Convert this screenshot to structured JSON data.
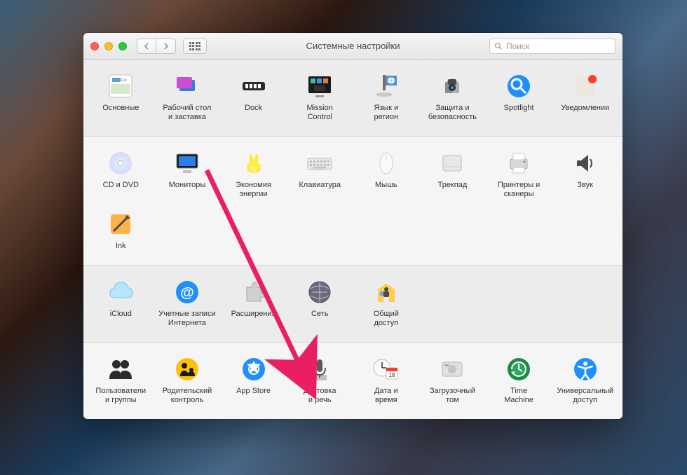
{
  "window": {
    "title": "Системные настройки",
    "search_placeholder": "Поиск"
  },
  "rows": [
    {
      "alt": false,
      "items": [
        {
          "id": "general",
          "label": "Основные"
        },
        {
          "id": "desktop",
          "label": "Рабочий стол\nи заставка"
        },
        {
          "id": "dock",
          "label": "Dock"
        },
        {
          "id": "mission",
          "label": "Mission\nControl"
        },
        {
          "id": "language",
          "label": "Язык и\nрегион"
        },
        {
          "id": "security",
          "label": "Защита и\nбезопасность"
        },
        {
          "id": "spotlight",
          "label": "Spotlight"
        },
        {
          "id": "notifications",
          "label": "Уведомления"
        }
      ]
    },
    {
      "alt": true,
      "items": [
        {
          "id": "cddvd",
          "label": "CD и DVD"
        },
        {
          "id": "displays",
          "label": "Мониторы"
        },
        {
          "id": "energy",
          "label": "Экономия\nэнергии"
        },
        {
          "id": "keyboard",
          "label": "Клавиатура"
        },
        {
          "id": "mouse",
          "label": "Мышь"
        },
        {
          "id": "trackpad",
          "label": "Трекпад"
        },
        {
          "id": "printers",
          "label": "Принтеры и\nсканеры"
        },
        {
          "id": "sound",
          "label": "Звук"
        }
      ],
      "items2": [
        {
          "id": "ink",
          "label": "Ink"
        }
      ]
    },
    {
      "alt": false,
      "items": [
        {
          "id": "icloud",
          "label": "iCloud"
        },
        {
          "id": "internet",
          "label": "Учетные записи\nИнтернета"
        },
        {
          "id": "extensions",
          "label": "Расширения"
        },
        {
          "id": "network",
          "label": "Сеть"
        },
        {
          "id": "sharing",
          "label": "Общий\nдоступ"
        }
      ]
    },
    {
      "alt": true,
      "items": [
        {
          "id": "users",
          "label": "Пользователи\nи группы"
        },
        {
          "id": "parental",
          "label": "Родительский\nконтроль"
        },
        {
          "id": "appstore",
          "label": "App Store"
        },
        {
          "id": "dictation",
          "label": "Диктовка\nи речь"
        },
        {
          "id": "datetime",
          "label": "Дата и\nвремя"
        },
        {
          "id": "startup",
          "label": "Загрузочный\nтом"
        },
        {
          "id": "timemachine",
          "label": "Time\nMachine"
        },
        {
          "id": "accessibility",
          "label": "Универсальный\nдоступ"
        }
      ]
    }
  ],
  "icons": {
    "general": "general-icon",
    "desktop": "desktop-screensaver-icon",
    "dock": "dock-icon",
    "mission": "mission-control-icon",
    "language": "language-region-icon",
    "security": "security-icon",
    "spotlight": "spotlight-icon",
    "notifications": "notifications-icon",
    "cddvd": "cd-dvd-icon",
    "displays": "displays-icon",
    "energy": "energy-saver-icon",
    "keyboard": "keyboard-icon",
    "mouse": "mouse-icon",
    "trackpad": "trackpad-icon",
    "printers": "printers-icon",
    "sound": "sound-icon",
    "ink": "ink-icon",
    "icloud": "icloud-icon",
    "internet": "internet-accounts-icon",
    "extensions": "extensions-icon",
    "network": "network-icon",
    "sharing": "sharing-icon",
    "users": "users-groups-icon",
    "parental": "parental-control-icon",
    "appstore": "app-store-icon",
    "dictation": "dictation-icon",
    "datetime": "date-time-icon",
    "startup": "startup-disk-icon",
    "timemachine": "time-machine-icon",
    "accessibility": "accessibility-icon"
  },
  "annotation": {
    "arrow_color": "#e91e63"
  }
}
